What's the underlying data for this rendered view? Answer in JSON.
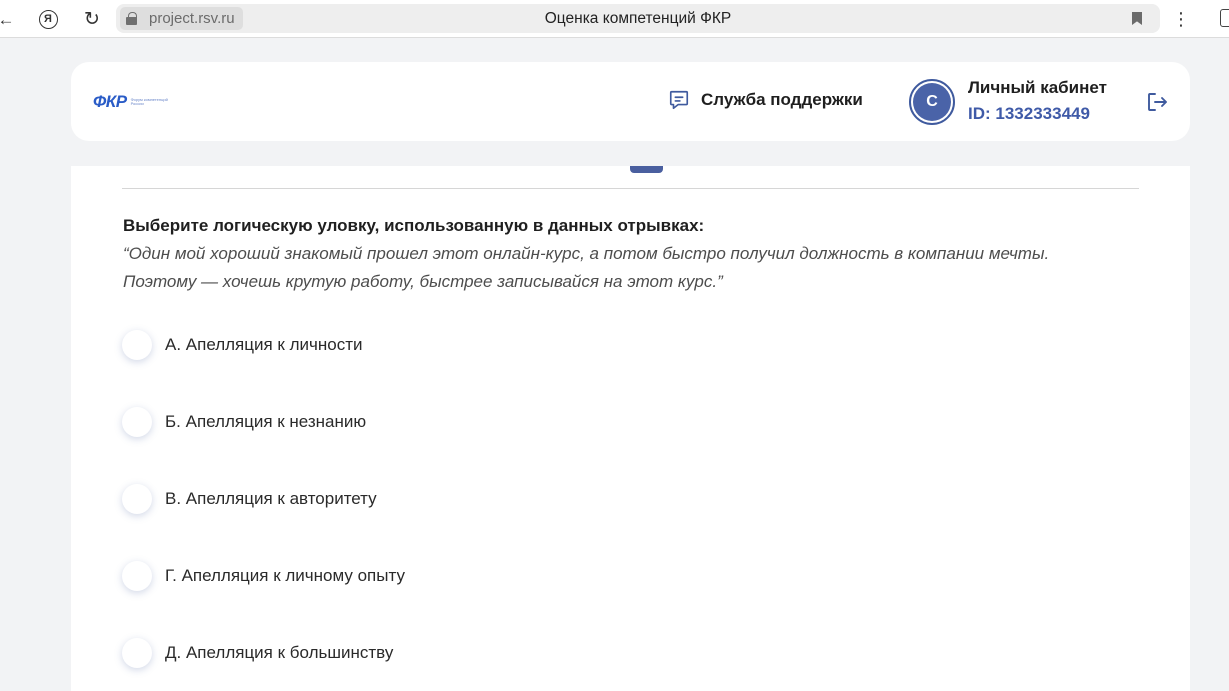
{
  "browser": {
    "url_host": "project.rsv.ru",
    "page_title": "Оценка компетенций ФКР"
  },
  "header": {
    "logo_text": "ФКР",
    "logo_tagline": "Форум компетенций России",
    "support_label": "Служба поддержки",
    "avatar_letter": "С",
    "cabinet_title": "Личный кабинет",
    "cabinet_id": "ID: 1332333449"
  },
  "quiz": {
    "question": "Выберите логическую уловку, использованную в данных отрывках:",
    "quote_line1": "“Один мой хороший знакомый прошел этот онлайн-курс, а потом быстро получил должность в компании мечты.",
    "quote_line2": "Поэтому — хочешь крутую работу, быстрее записывайся на этот курс.”",
    "options": [
      {
        "label": "А. Апелляция к личности"
      },
      {
        "label": "Б. Апелляция к незнанию"
      },
      {
        "label": "В. Апелляция к авторитету"
      },
      {
        "label": "Г. Апелляция к личному опыту"
      },
      {
        "label": "Д. Апелляция к большинству"
      }
    ]
  },
  "colors": {
    "accent": "#4a5f9f",
    "id_text": "#3f5aa8",
    "logo": "#2a5cc7",
    "page_bg": "#f2f3f5"
  },
  "icons": {
    "back": "arrow-left-icon",
    "browser_logo": "yandex-icon",
    "reload": "reload-icon",
    "lock": "lock-icon",
    "bookmark": "bookmark-icon",
    "menu": "kebab-menu-icon",
    "support": "chat-bubble-icon",
    "logout": "logout-icon"
  }
}
